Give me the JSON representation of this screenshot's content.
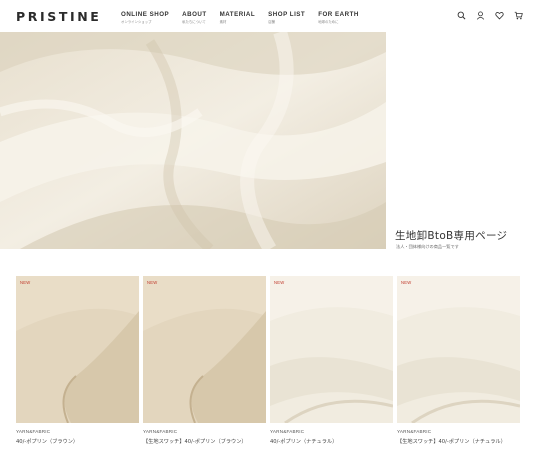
{
  "header": {
    "logo": "PRISTINE",
    "nav": [
      {
        "en": "ONLINE SHOP",
        "jp": "オンラインショップ"
      },
      {
        "en": "ABOUT",
        "jp": "私たちについて"
      },
      {
        "en": "MATERIAL",
        "jp": "素材"
      },
      {
        "en": "SHOP LIST",
        "jp": "店舗"
      },
      {
        "en": "FOR EARTH",
        "jp": "地球のために"
      }
    ],
    "icons": [
      "search-icon",
      "account-icon",
      "favorite-icon",
      "cart-icon"
    ]
  },
  "hero": {
    "title": "生地卸BtoB専用ページ",
    "subtitle": "法人・団体様向けの商品一覧です"
  },
  "products": [
    {
      "badge": "NEW",
      "category": "YARN&FABRIC",
      "name": "40/-ポプリン（ブラウン）",
      "color": "#e2d5bd"
    },
    {
      "badge": "NEW",
      "category": "YARN&FABRIC",
      "name": "【生地スワッチ】40/-ポプリン（ブラウン）",
      "color": "#e2d5bd"
    },
    {
      "badge": "NEW",
      "category": "YARN&FABRIC",
      "name": "40/-ポプリン（ナチュラル）",
      "color": "#f0ebdd"
    },
    {
      "badge": "NEW",
      "category": "YARN&FABRIC",
      "name": "【生地スワッチ】40/-ポプリン（ナチュラル）",
      "color": "#f0ebdd"
    }
  ],
  "colors": {
    "badge": "#c0392b",
    "brown_fabric": "#e2d5bd",
    "natural_fabric": "#f0ebdd",
    "hero_fabric": "#ece5d6"
  }
}
